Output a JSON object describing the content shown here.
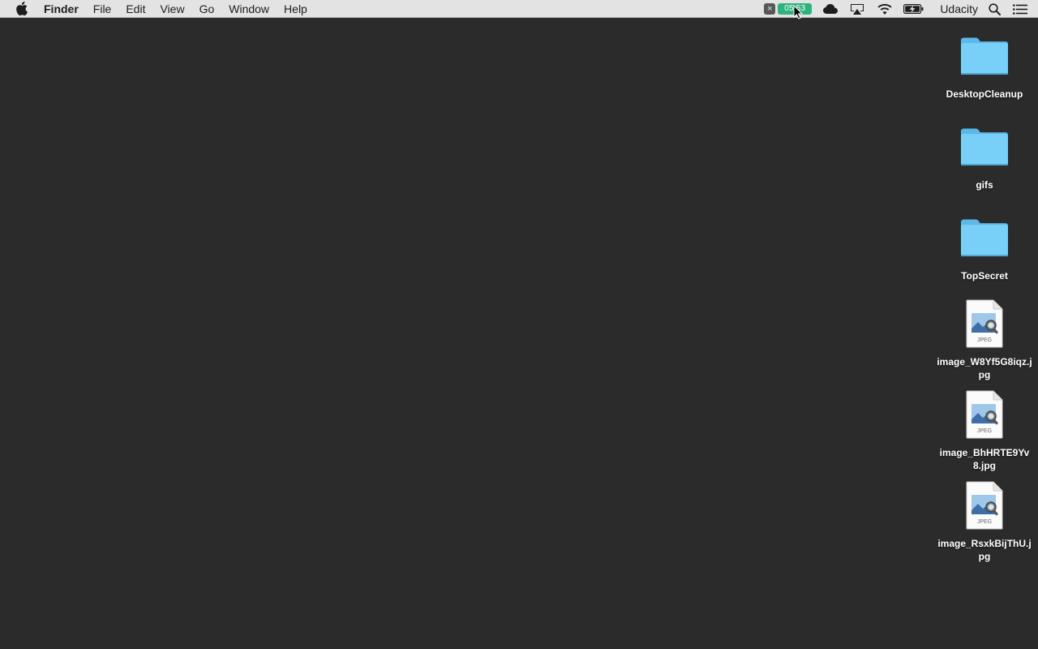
{
  "menubar": {
    "app_name": "Finder",
    "menus": [
      "File",
      "Edit",
      "View",
      "Go",
      "Window",
      "Help"
    ],
    "status": {
      "close_glyph": "×",
      "timer_text": "05:53",
      "icons": [
        "cloud-icon",
        "airplay-icon",
        "wifi-icon",
        "battery-charging-icon",
        "search-icon",
        "notification-center-icon"
      ],
      "user_name": "Udacity"
    }
  },
  "desktop": {
    "items": [
      {
        "type": "folder",
        "name": "DesktopCleanup"
      },
      {
        "type": "folder",
        "name": "gifs"
      },
      {
        "type": "folder",
        "name": "TopSecret"
      },
      {
        "type": "jpeg",
        "name": "image_W8Yf5G8iqz.jpg",
        "badge": "JPEG"
      },
      {
        "type": "jpeg",
        "name": "image_BhHRTE9Yv8.jpg",
        "badge": "JPEG"
      },
      {
        "type": "jpeg",
        "name": "image_RsxkBijThU.jpg",
        "badge": "JPEG"
      }
    ]
  },
  "colors": {
    "desktop_bg": "#2b2b2b",
    "menubar_bg": "#e3e3e3",
    "timer_green": "#2fb37c",
    "folder_blue": "#6ecbf6"
  }
}
